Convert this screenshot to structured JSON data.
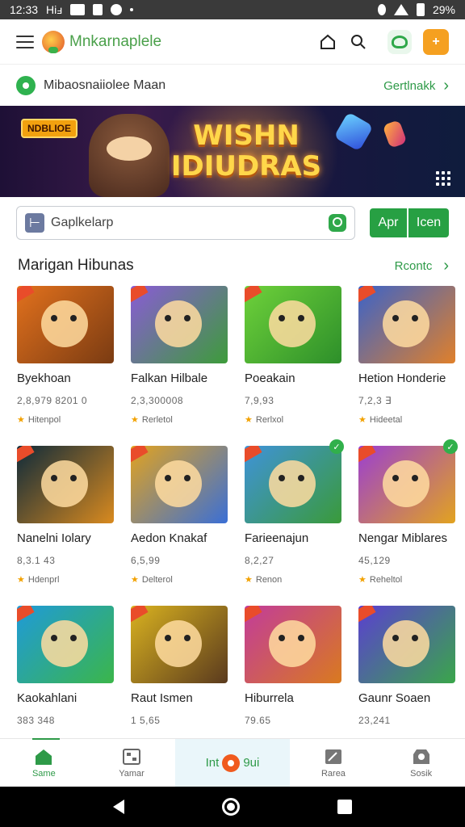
{
  "status_bar": {
    "time": "12:33",
    "carrier": "Hiⅎ",
    "battery": "29%"
  },
  "header": {
    "brand": "Mnkarnaplele"
  },
  "location": {
    "label": "Mibaosnaiiolee Maan",
    "link": "Gertlnakk"
  },
  "banner": {
    "tag": "NDBLIOE",
    "title_line1": "WISHN",
    "title_line2": "IDIUDRAS"
  },
  "search": {
    "value": "Gaplkelarp"
  },
  "toggle": {
    "left": "Apr",
    "right": "Icen"
  },
  "section": {
    "title": "Marigan Hibunas",
    "link": "Rcontc"
  },
  "games": [
    {
      "title": "Byekhoan",
      "meta": "2,8,979 8201 0",
      "rating": "Hitenpol",
      "colors": [
        "#e2711d",
        "#7a3b12"
      ],
      "badge": false
    },
    {
      "title": "Falkan Hilbale",
      "meta": "2,3,300008",
      "rating": "Rerletol",
      "colors": [
        "#8a5bd6",
        "#3d9c3a"
      ],
      "badge": false
    },
    {
      "title": "Poeakain",
      "meta": "7,9,93",
      "rating": "Rerlxol",
      "colors": [
        "#6ed13a",
        "#2d8f2a"
      ],
      "badge": false
    },
    {
      "title": "Hetion Honderie",
      "meta": "7,2,3 ∃",
      "rating": "Hideetal",
      "colors": [
        "#3b63c9",
        "#e0802a"
      ],
      "badge": false
    },
    {
      "title": "Nanelni Iolary",
      "meta": "8,3.1 43",
      "rating": "Hdenprl",
      "colors": [
        "#0e2a3a",
        "#d98a1f"
      ],
      "badge": false
    },
    {
      "title": "Aedon Knakaf",
      "meta": "6,5,99",
      "rating": "Delterol",
      "colors": [
        "#e2a31f",
        "#3a6fd6"
      ],
      "badge": false
    },
    {
      "title": "Farieenajun",
      "meta": "8,2,27",
      "rating": "Renon",
      "colors": [
        "#3f93d9",
        "#3a9a3a"
      ],
      "badge": true
    },
    {
      "title": "Nengar Miblares",
      "meta": "45,129",
      "rating": "Reheltol",
      "colors": [
        "#9b3fd1",
        "#e2a31f"
      ],
      "badge": true
    },
    {
      "title": "Kaokahlani",
      "meta": "383 348",
      "rating": "",
      "colors": [
        "#1f9ad9",
        "#3bb64a"
      ],
      "badge": false
    },
    {
      "title": "Raut Ismen",
      "meta": "1 5,65",
      "rating": "",
      "colors": [
        "#d9b21f",
        "#5a3a1e"
      ],
      "badge": false
    },
    {
      "title": "Hiburrela",
      "meta": "79.65",
      "rating": "",
      "colors": [
        "#c23c9a",
        "#d97a1f"
      ],
      "badge": false
    },
    {
      "title": "Gaunr Soaen",
      "meta": "23,241",
      "rating": "",
      "colors": [
        "#5b3fd1",
        "#3aa64a"
      ],
      "badge": false
    }
  ],
  "bottom_nav": {
    "home": "Same",
    "games": "Yamar",
    "center_left": "Int",
    "center_right": "9ui",
    "rewards": "Rarea",
    "social": "Sosik"
  }
}
